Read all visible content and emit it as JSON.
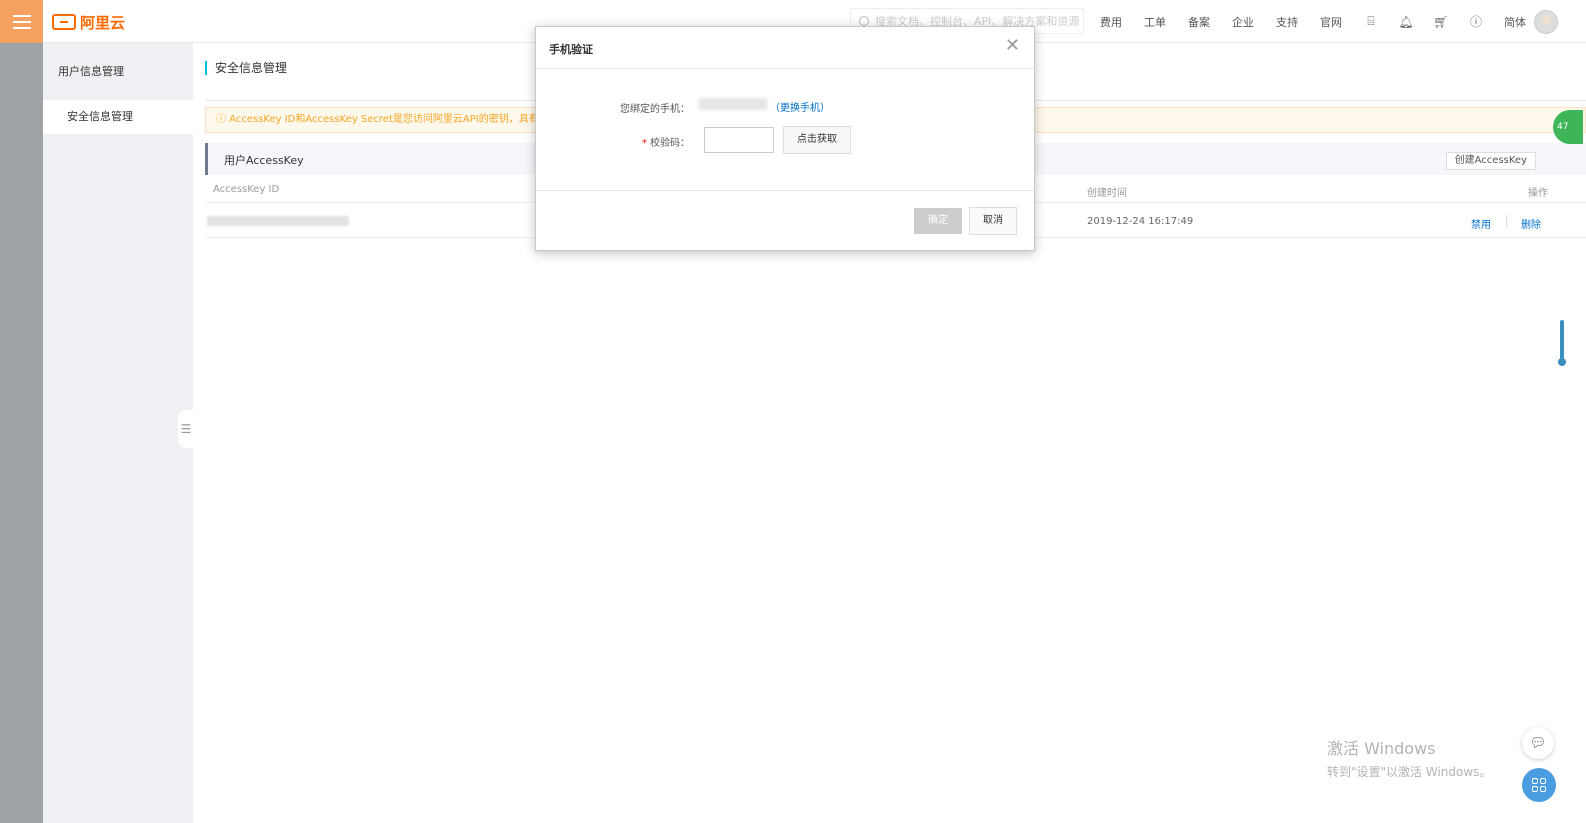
{
  "topbar": {
    "logo_text": "阿里云",
    "search_placeholder": "搜索文档、控制台、API、解决方案和资源",
    "nav": [
      "费用",
      "工单",
      "备案",
      "企业",
      "支持",
      "官网"
    ],
    "lang": "简体",
    "icons": [
      "terminal-icon",
      "bell-icon",
      "cart-icon",
      "help-icon"
    ]
  },
  "sidebar": {
    "title": "用户信息管理",
    "items": [
      {
        "label": "安全信息管理"
      }
    ]
  },
  "main": {
    "page_title": "安全信息管理",
    "notice": "ⓘ AccessKey ID和AccessKey Secret是您访问阿里云API的密钥，具有该...",
    "panel_title": "用户AccessKey",
    "create_button": "创建AccessKey",
    "columns": {
      "id": "AccessKey ID",
      "created": "创建时间",
      "actions": "操作"
    },
    "rows": [
      {
        "created": "2019-12-24 16:17:49",
        "disable": "禁用",
        "delete": "删除"
      }
    ]
  },
  "badge_text": "47",
  "modal": {
    "title": "手机验证",
    "phone_label": "您绑定的手机：",
    "change_phone": "（更换手机）",
    "code_label": "校验码：",
    "required_mark": "*",
    "get_code": "点击获取",
    "ok": "确定",
    "cancel": "取消"
  },
  "watermark": {
    "line1": "激活 Windows",
    "line2": "转到\"设置\"以激活 Windows。"
  },
  "colors": {
    "brand": "#ff6a00",
    "menu_bg": "#f6a160",
    "link": "#0070cc",
    "notice_text": "#f5a623",
    "accent_bar": "#00c1de"
  }
}
